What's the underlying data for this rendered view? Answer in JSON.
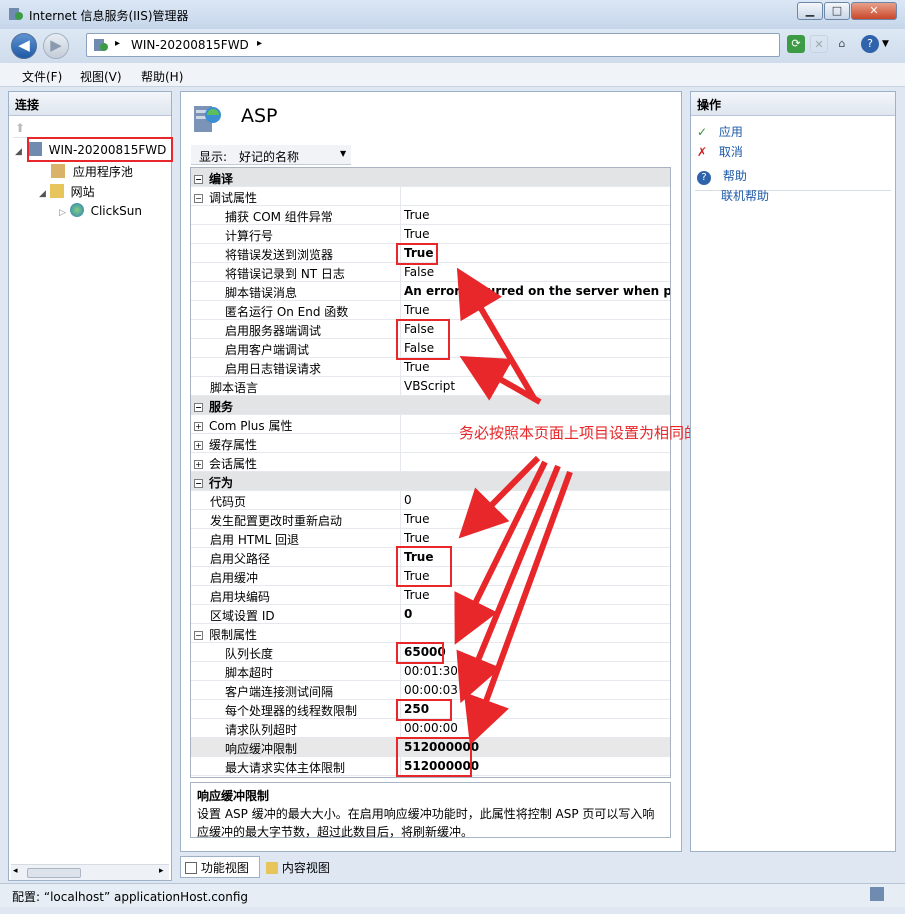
{
  "window": {
    "title": "Internet 信息服务(IIS)管理器",
    "min": "▁",
    "max": "□",
    "close": "✕"
  },
  "nav": {
    "back": "◀",
    "forward": "▶",
    "address": "WIN-20200815FWD",
    "arrow": "▸",
    "help_label": "?"
  },
  "menu": [
    "文件(F)",
    "视图(V)",
    "帮助(H)"
  ],
  "left": {
    "title": "连接",
    "tree": {
      "server": "WIN-20200815FWD",
      "apppool": "应用程序池",
      "sites": "网站",
      "site": "ClickSun"
    }
  },
  "center": {
    "title": "ASP",
    "show_label": "显示:",
    "show_value": "好记的名称",
    "rows": [
      {
        "k": "编译",
        "v": "",
        "t": "cat",
        "e": "⊟"
      },
      {
        "k": "调试属性",
        "v": "",
        "t": "sub",
        "e": "⊟"
      },
      {
        "k": "捕获 COM 组件异常",
        "v": "True",
        "t": "i2"
      },
      {
        "k": "计算行号",
        "v": "True",
        "t": "i2"
      },
      {
        "k": "将错误发送到浏览器",
        "v": "True",
        "t": "i2",
        "b": 1
      },
      {
        "k": "将错误记录到 NT 日志",
        "v": "False",
        "t": "i2"
      },
      {
        "k": "脚本错误消息",
        "v": "An error occurred on the server when proce",
        "t": "i2",
        "b": 1
      },
      {
        "k": "匿名运行 On End 函数",
        "v": "True",
        "t": "i2"
      },
      {
        "k": "启用服务器端调试",
        "v": "False",
        "t": "i2"
      },
      {
        "k": "启用客户端调试",
        "v": "False",
        "t": "i2"
      },
      {
        "k": "启用日志错误请求",
        "v": "True",
        "t": "i2"
      },
      {
        "k": "脚本语言",
        "v": "VBScript",
        "t": "i1"
      },
      {
        "k": "服务",
        "v": "",
        "t": "cat",
        "e": "⊟"
      },
      {
        "k": "Com Plus 属性",
        "v": "",
        "t": "sub",
        "e": "⊞"
      },
      {
        "k": "缓存属性",
        "v": "",
        "t": "sub",
        "e": "⊞"
      },
      {
        "k": "会话属性",
        "v": "",
        "t": "sub",
        "e": "⊞"
      },
      {
        "k": "行为",
        "v": "",
        "t": "cat",
        "e": "⊟"
      },
      {
        "k": "代码页",
        "v": "0",
        "t": "i1"
      },
      {
        "k": "发生配置更改时重新启动",
        "v": "True",
        "t": "i1"
      },
      {
        "k": "启用 HTML 回退",
        "v": "True",
        "t": "i1"
      },
      {
        "k": "启用父路径",
        "v": "True",
        "t": "i1",
        "b": 1
      },
      {
        "k": "启用缓冲",
        "v": "True",
        "t": "i1"
      },
      {
        "k": "启用块编码",
        "v": "True",
        "t": "i1"
      },
      {
        "k": "区域设置 ID",
        "v": "0",
        "t": "i1",
        "b": 1
      },
      {
        "k": "限制属性",
        "v": "",
        "t": "sub",
        "e": "⊟"
      },
      {
        "k": "队列长度",
        "v": "65000",
        "t": "i2",
        "b": 1
      },
      {
        "k": "脚本超时",
        "v": "00:01:30",
        "t": "i2"
      },
      {
        "k": "客户端连接测试间隔",
        "v": "00:00:03",
        "t": "i2"
      },
      {
        "k": "每个处理器的线程数限制",
        "v": "250",
        "t": "i2",
        "b": 1
      },
      {
        "k": "请求队列超时",
        "v": "00:00:00",
        "t": "i2"
      },
      {
        "k": "响应缓冲限制",
        "v": "512000000",
        "t": "i2",
        "b": 1,
        "sel": 1
      },
      {
        "k": "最大请求实体主体限制",
        "v": "512000000",
        "t": "i2",
        "b": 1
      }
    ],
    "desc_title": "响应缓冲限制",
    "desc_text": "设置 ASP 缓冲的最大大小。在启用响应缓冲功能时，此属性将控制 ASP 页可以写入响应缓冲的最大字节数，超过此数目后，将刷新缓冲。",
    "tab_features": "功能视图",
    "tab_content": "内容视图"
  },
  "annotation": "务必按照本页面上项目设置为相同的值",
  "right": {
    "title": "操作",
    "apply": "应用",
    "cancel": "取消",
    "help": "帮助",
    "online_help": "联机帮助"
  },
  "status": {
    "text": "配置: “localhost” applicationHost.config"
  },
  "colors": {
    "accent": "#1e5aa8",
    "annotation": "#e8272a",
    "category_bg": "#e3e4e6"
  }
}
